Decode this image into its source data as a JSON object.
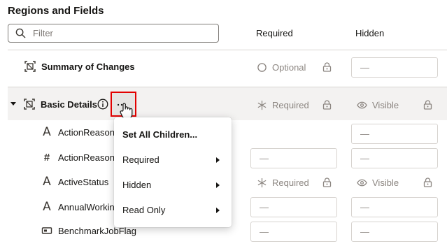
{
  "page": {
    "title": "Regions and Fields"
  },
  "filter": {
    "placeholder": "Filter"
  },
  "columns": {
    "required": "Required",
    "hidden": "Hidden"
  },
  "regions": {
    "summary": {
      "label": "Summary of Changes",
      "required_status": "Optional",
      "hidden_value": "—"
    },
    "basic": {
      "label": "Basic Details",
      "required_status": "Required",
      "hidden_status": "Visible",
      "more_label": "..."
    }
  },
  "fields": [
    {
      "icon": "text-type-icon",
      "label": "ActionReason",
      "hidden_value": "—"
    },
    {
      "icon": "number-type-icon",
      "label": "ActionReason",
      "required_value": "—",
      "hidden_value": "—"
    },
    {
      "icon": "text-type-icon",
      "label": "ActiveStatus",
      "required_status": "Required",
      "hidden_status": "Visible"
    },
    {
      "icon": "text-type-icon",
      "label": "AnnualWorkin",
      "required_value": "—",
      "hidden_value": "—"
    },
    {
      "icon": "flag-type-icon",
      "label": "BenchmarkJobFlag",
      "required_value": "—",
      "hidden_value": "—"
    }
  ],
  "menu": {
    "heading": "Set All Children...",
    "items": [
      "Required",
      "Hidden",
      "Read Only"
    ]
  },
  "colors": {
    "highlight_border": "#e20000",
    "band": "#f3f2f1",
    "muted": "#8b8580"
  }
}
